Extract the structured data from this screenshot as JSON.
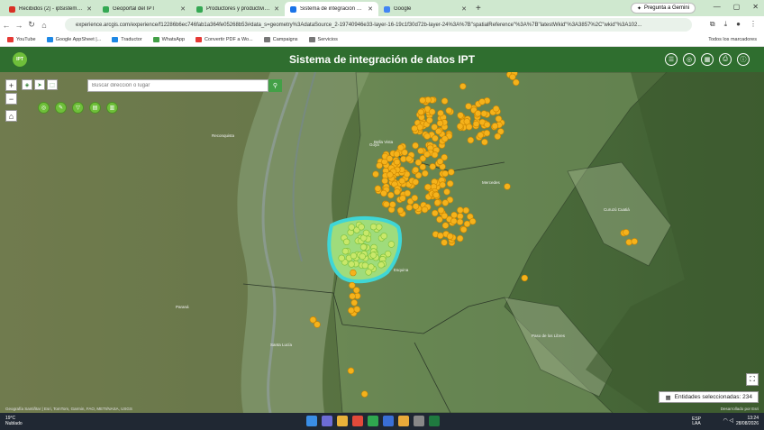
{
  "browser": {
    "tabs": [
      {
        "title": "Recibidos (2) - iptsistema@gm...",
        "color": "#d93025"
      },
      {
        "title": "Geoportal del IPT",
        "color": "#34a853"
      },
      {
        "title": "Productores y productividad",
        "color": "#34a853"
      },
      {
        "title": "Sistema de integración de dato",
        "color": "#1a73e8"
      },
      {
        "title": "Google",
        "color": "#4285f4"
      }
    ],
    "gemini_label": "Pregunta a Gemini",
    "url": "experience.arcgis.com/experience/f12286b6ec746fab1a364fe05268b53#data_s=geometry%3AdataSource_2-19740946e33-layer-16-19c1f30d72b-layer-24%3A%7B\"spatialReference\"%3A%7B\"latestWkid\"%3A3857%2C\"wkid\"%3A102...",
    "bookmarks": [
      {
        "label": "YouTube",
        "color": "#e53935"
      },
      {
        "label": "Google AppSheet |...",
        "color": "#1e88e5"
      },
      {
        "label": "Traductor",
        "color": "#1e88e5"
      },
      {
        "label": "WhatsApp",
        "color": "#43a047"
      },
      {
        "label": "Convertir PDF a Wo...",
        "color": "#e53935"
      },
      {
        "label": "Campaigns",
        "color": "#777777"
      },
      {
        "label": "Servicios",
        "color": "#777777"
      }
    ],
    "all_bookmarks": "Todos los marcadores"
  },
  "app": {
    "logo_text": "IPT",
    "title": "Sistema de integración de datos IPT",
    "header_icons": [
      "list-icon",
      "layers-icon",
      "table-icon",
      "print-icon",
      "info-icon"
    ]
  },
  "map": {
    "search_placeholder": "Buscar dirección o lugar",
    "zoom_in": "+",
    "zoom_out": "−",
    "home": "⌂",
    "selected_label": "Entidades seleccionadas: 234",
    "attribution": "Geografía Santiñtar | Esri, TomTom, Garmin, FAO, METI/NASA, USGS",
    "powered_by": "Desarrollado por Esri",
    "labels": [
      {
        "text": "Reconquista"
      },
      {
        "text": "Goya"
      },
      {
        "text": "Esquina"
      },
      {
        "text": "Mercedes"
      },
      {
        "text": "Paso de los Libres"
      },
      {
        "text": "Curuzú Cuatiá"
      },
      {
        "text": "Santa Lucía"
      },
      {
        "text": "Paraná"
      },
      {
        "text": "Bella Vista"
      }
    ]
  },
  "taskbar": {
    "temperature": "19°C",
    "weather": "Nublado",
    "lang": "ESP",
    "lang2": "LAA",
    "time": "13:24",
    "date": "28/08/2026"
  }
}
